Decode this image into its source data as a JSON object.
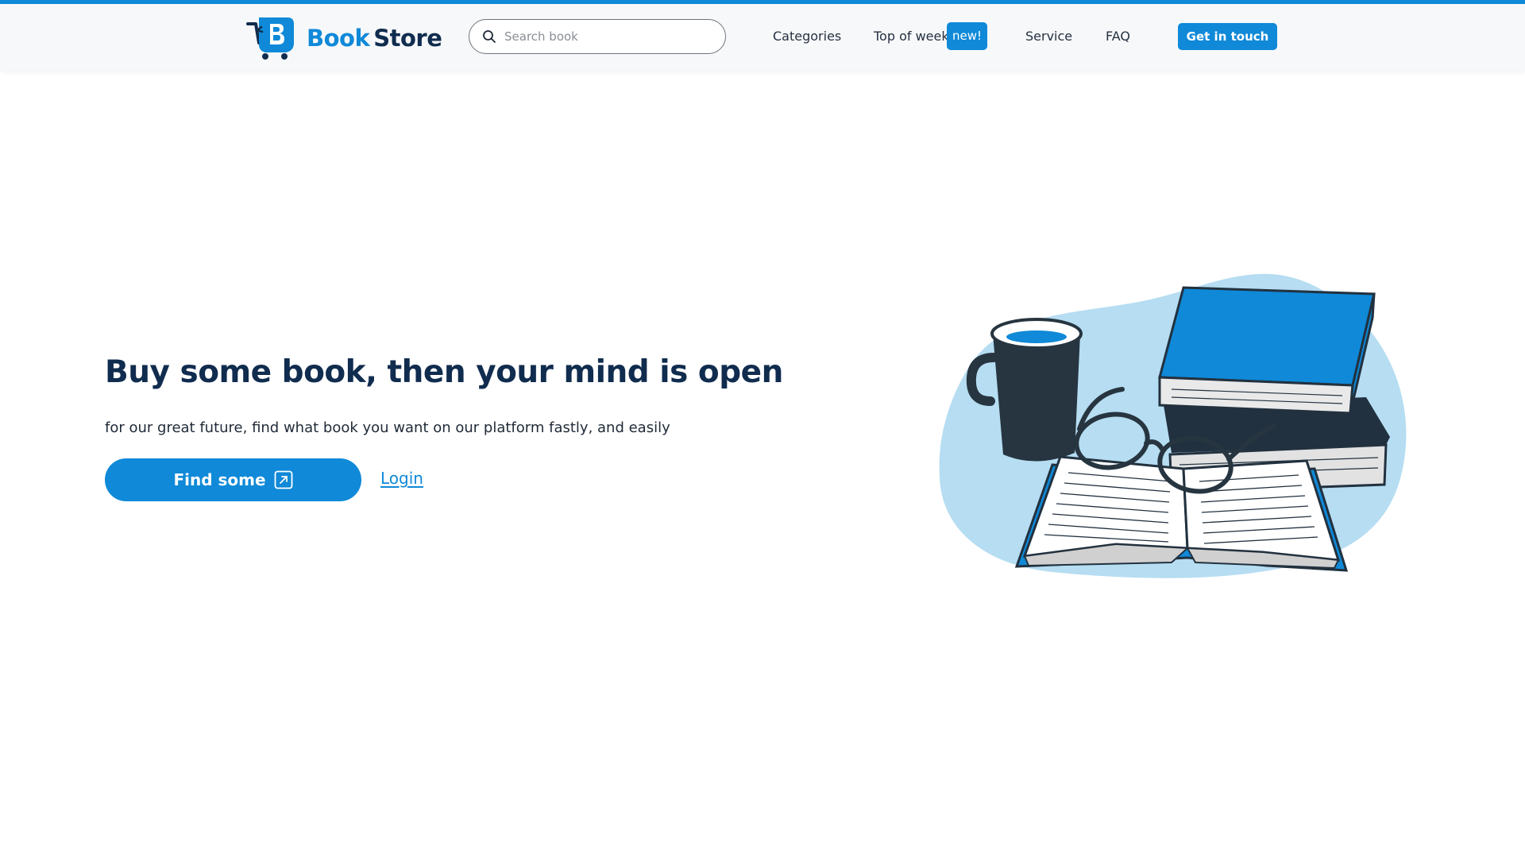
{
  "brand": {
    "name_part1": "Book",
    "name_part2": "Store",
    "logo_icon": "cart-book-icon",
    "accent_color": "#0f89d8",
    "dark_color": "#102c4e"
  },
  "search": {
    "placeholder": "Search book",
    "value": "",
    "icon": "search-icon"
  },
  "nav": {
    "categories": "Categories",
    "top_of_week": "Top of week",
    "new_badge": "new!",
    "service": "Service",
    "faq": "FAQ",
    "contact_button": "Get in touch"
  },
  "hero": {
    "title": "Buy some book, then your mind is open",
    "subtitle": "for our great future, find what book you want on our platform fastly, and easily",
    "primary_button": "Find some",
    "primary_button_icon": "arrow-up-right-icon",
    "secondary_link": "Login",
    "illustration": "books-coffee-glasses-illustration"
  }
}
